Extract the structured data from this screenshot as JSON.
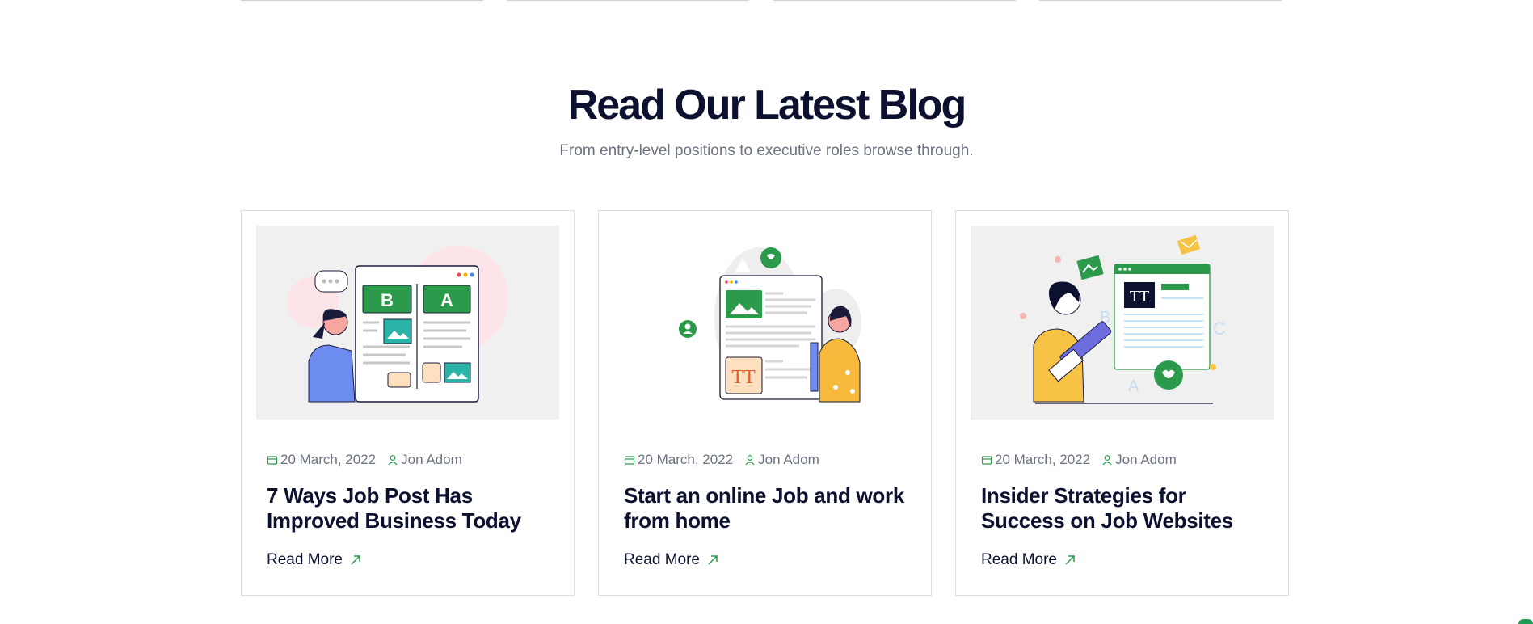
{
  "section": {
    "title": "Read Our Latest Blog",
    "subtitle": "From entry-level positions to executive roles browse through."
  },
  "colors": {
    "accent_green": "#2b9a4a",
    "heading_navy": "#0c1130",
    "muted_text": "#6b7280"
  },
  "posts": [
    {
      "date": "20 March, 2022",
      "author": "Jon Adom",
      "title": "7 Ways Job Post Has Improved Business Today",
      "read_more": "Read More",
      "image_icon": "ab-testing-illustration"
    },
    {
      "date": "20 March, 2022",
      "author": "Jon Adom",
      "title": "Start an online Job and work from home",
      "read_more": "Read More",
      "image_icon": "content-editing-illustration"
    },
    {
      "date": "20 March, 2022",
      "author": "Jon Adom",
      "title": "Insider Strategies for Success on Job Websites",
      "read_more": "Read More",
      "image_icon": "writing-pencil-illustration"
    }
  ],
  "icons": {
    "date": "calendar-icon",
    "author": "user-icon",
    "read_more": "arrow-up-right-icon"
  }
}
